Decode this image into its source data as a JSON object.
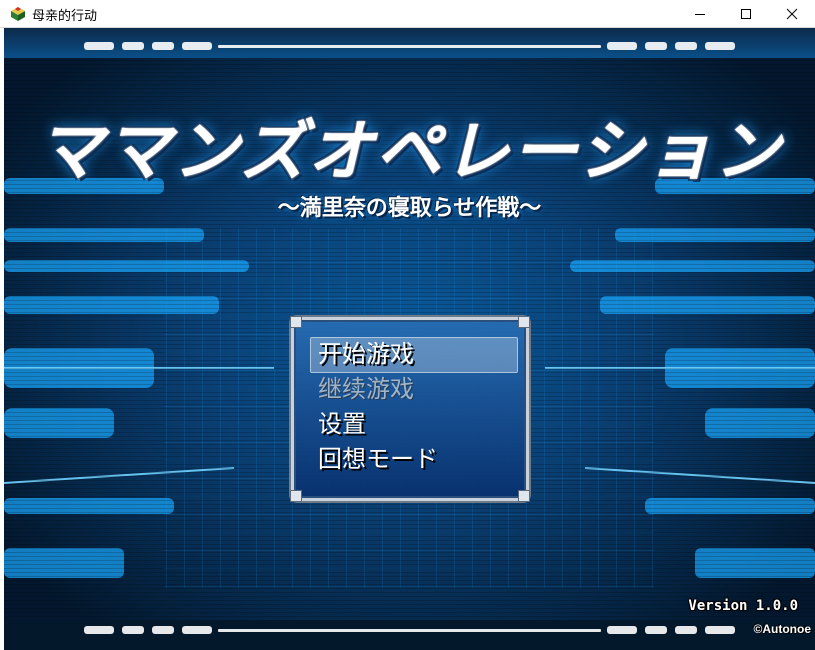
{
  "window": {
    "title": "母亲的行动",
    "icon": "game-app-icon",
    "controls": [
      "minimize-icon",
      "maximize-icon",
      "close-icon"
    ]
  },
  "game": {
    "logo": "ママンズオペレーション",
    "subtitle": "～満里奈の寝取らせ作戦～",
    "menu": {
      "items": [
        {
          "label": "开始游戏",
          "selected": true,
          "enabled": true
        },
        {
          "label": "继续游戏",
          "selected": false,
          "enabled": false
        },
        {
          "label": "设置",
          "selected": false,
          "enabled": true
        },
        {
          "label": "回想モード",
          "selected": false,
          "enabled": true
        }
      ]
    },
    "version": "Version 1.0.0",
    "copyright": "©Autonoe"
  },
  "colors": {
    "background_dark": "#04203a",
    "background_cyan": "#12a8ff",
    "window_fill_top": "#286eb4",
    "window_fill_bottom": "#08306e",
    "window_border": "#c9d2dc"
  }
}
